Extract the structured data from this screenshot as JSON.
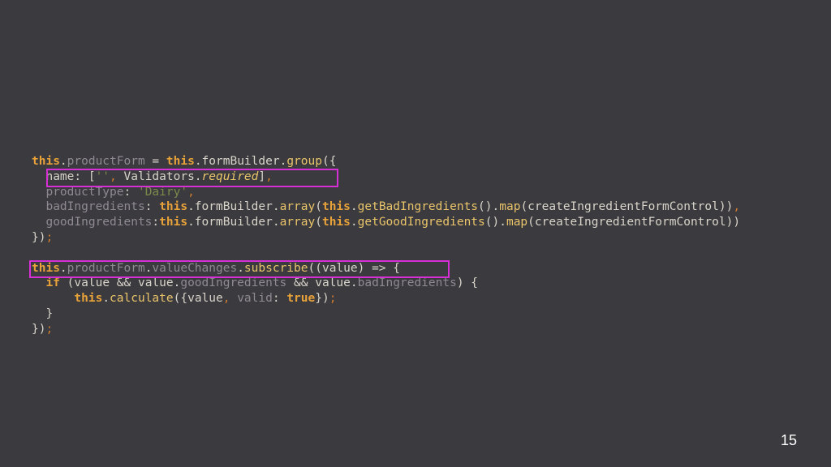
{
  "code": {
    "l1": {
      "kw1": "this",
      "p1": ".",
      "prop": "productForm",
      "p2": " = ",
      "kw2": "this",
      "p3": ".formBuilder.",
      "fn": "group",
      "p4": "({"
    },
    "l2": {
      "indent": "  ",
      "a": "name: [",
      "str": "''",
      "comma": ",",
      "b": " Validators.",
      "it": "required",
      "c": "]",
      "comma2": ","
    },
    "l3": {
      "indent": "  ",
      "prop": "productType",
      "a": ": ",
      "str": "'Dairy'",
      "comma": ","
    },
    "l4": {
      "indent": "  ",
      "prop": "badIngredients",
      "a": ": ",
      "kw1": "this",
      "b": ".formBuilder.",
      "fn1": "array",
      "c": "(",
      "kw2": "this",
      "d": ".",
      "fn2": "getBadIngredients",
      "e": "().",
      "fn3": "map",
      "f": "(createIngredientFormControl))",
      "comma": ","
    },
    "l5": {
      "indent": "  ",
      "prop": "goodIngredients",
      "a": ":",
      "kw1": "this",
      "b": ".formBuilder.",
      "fn1": "array",
      "c": "(",
      "kw2": "this",
      "d": ".",
      "fn2": "getGoodIngredients",
      "e": "().",
      "fn3": "map",
      "f": "(createIngredientFormControl))"
    },
    "l6": {
      "a": "})",
      "comma": ";"
    },
    "l8": {
      "kw": "this",
      "a": ".",
      "prop1": "productForm",
      "b": ".",
      "prop2": "valueChanges",
      "c": ".",
      "fn": "subscribe",
      "d": "((value) => {"
    },
    "l9": {
      "indent": "  ",
      "kw": "if",
      "a": " (value && value.",
      "prop1": "goodIngredients",
      "b": " && value.",
      "prop2": "badIngredients",
      "c": ") {"
    },
    "l10": {
      "indent": "      ",
      "kw1": "this",
      "a": ".",
      "fn": "calculate",
      "b": "({value",
      "comma1": ",",
      "prop": " valid",
      "c": ": ",
      "kw2": "true",
      "d": "})",
      "comma2": ";"
    },
    "l11": {
      "indent": "  ",
      "a": "}"
    },
    "l12": {
      "a": "})",
      "comma": ";"
    }
  },
  "page_number": "15",
  "colors": {
    "highlight": "#d62fd6",
    "background": "#3b3a3e",
    "keyword": "#e8a23a"
  }
}
